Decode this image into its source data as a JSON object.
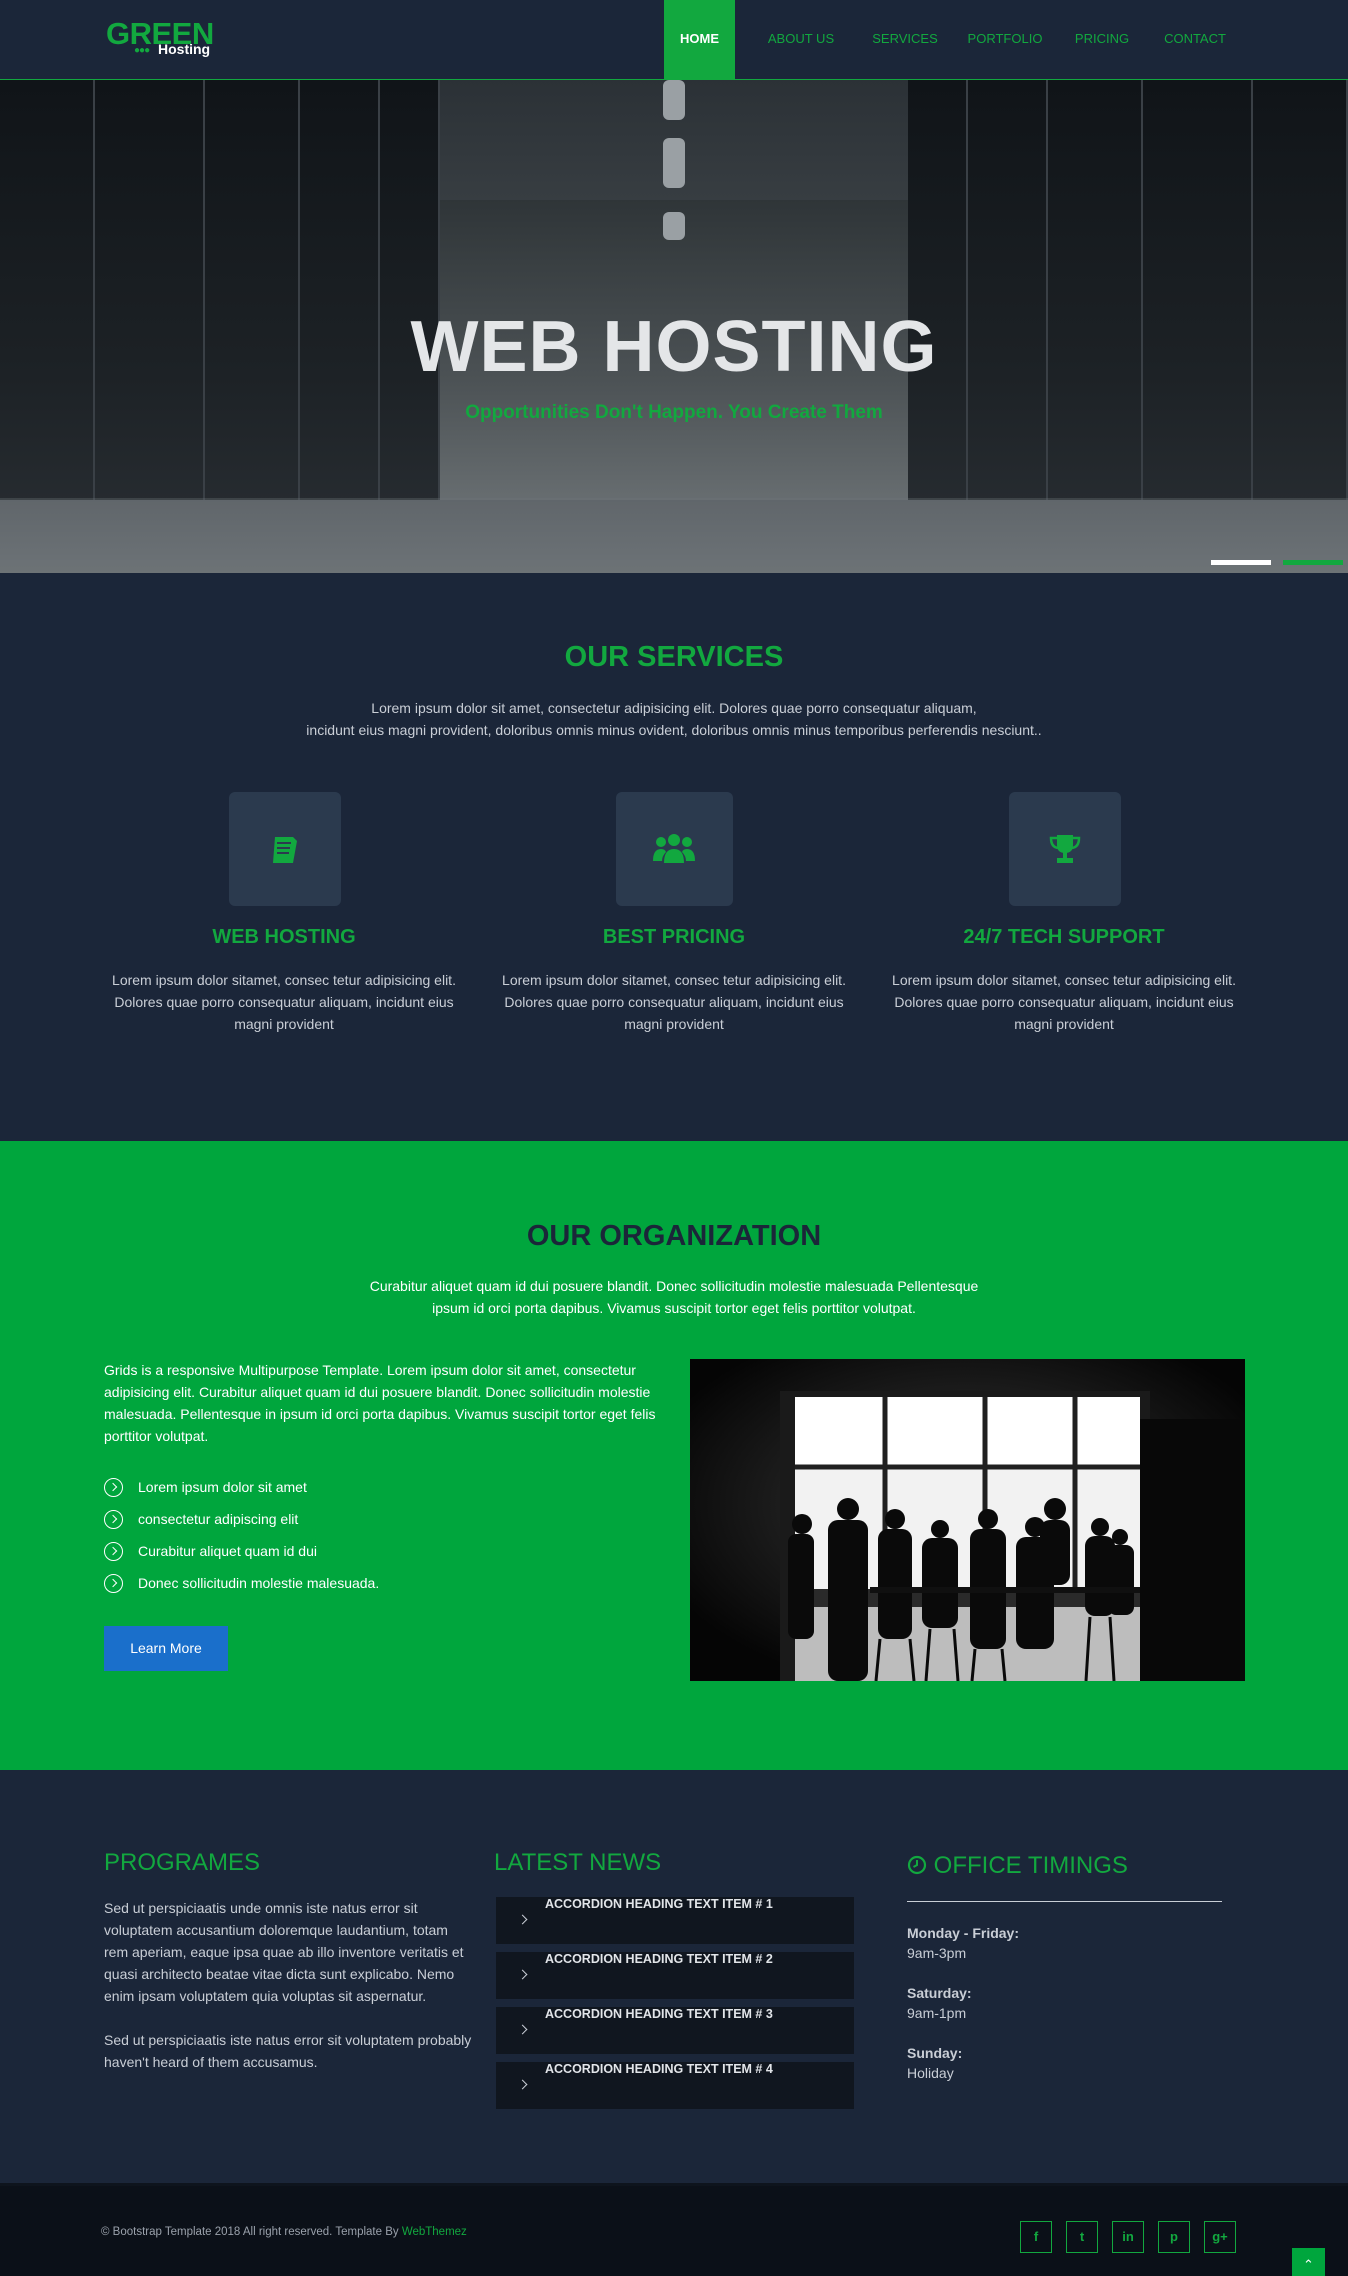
{
  "brand": {
    "logo_main": "GREEN",
    "logo_sub": "Hosting"
  },
  "nav": {
    "items": [
      {
        "label": "HOME",
        "active": true
      },
      {
        "label": "ABOUT US",
        "active": false
      },
      {
        "label": "SERVICES",
        "active": false
      },
      {
        "label": "PORTFOLIO",
        "active": false
      },
      {
        "label": "PRICING",
        "active": false
      },
      {
        "label": "CONTACT",
        "active": false
      }
    ]
  },
  "hero": {
    "title": "WEB HOSTING",
    "subtitle": "Opportunities Don't Happen. You Create Them",
    "slides": 2,
    "active_slide": 1
  },
  "services": {
    "title": "OUR SERVICES",
    "desc_line1": "Lorem ipsum dolor sit amet, consectetur adipisicing elit. Dolores quae porro consequatur aliquam,",
    "desc_line2": "incidunt eius magni provident, doloribus omnis minus ovident, doloribus omnis minus temporibus perferendis nesciunt..",
    "items": [
      {
        "icon": "book-icon",
        "title": "WEB HOSTING",
        "text": "Lorem ipsum dolor sitamet, consec tetur adipisicing elit. Dolores quae porro consequatur aliquam, incidunt eius magni provident"
      },
      {
        "icon": "users-icon",
        "title": "BEST PRICING",
        "text": "Lorem ipsum dolor sitamet, consec tetur adipisicing elit. Dolores quae porro consequatur aliquam, incidunt eius magni provident"
      },
      {
        "icon": "trophy-icon",
        "title": "24/7 TECH SUPPORT",
        "text": "Lorem ipsum dolor sitamet, consec tetur adipisicing elit. Dolores quae porro consequatur aliquam, incidunt eius magni provident"
      }
    ]
  },
  "organization": {
    "title": "OUR ORGANIZATION",
    "desc_line1": "Curabitur aliquet quam id dui posuere blandit. Donec sollicitudin molestie malesuada Pellentesque",
    "desc_line2": "ipsum id orci porta dapibus. Vivamus suscipit tortor eget felis porttitor volutpat.",
    "paragraph": "Grids is a responsive Multipurpose Template. Lorem ipsum dolor sit amet, consectetur adipisicing elit. Curabitur aliquet quam id dui posuere blandit. Donec sollicitudin molestie malesuada. Pellentesque in ipsum id orci porta dapibus. Vivamus suscipit tortor eget felis porttitor volutpat.",
    "list": [
      "Lorem ipsum dolor sit amet",
      "consectetur adipiscing elit",
      "Curabitur aliquet quam id dui",
      "Donec sollicitudin molestie malesuada."
    ],
    "button_label": "Learn More"
  },
  "programes": {
    "title": "PROGRAMES",
    "para1": "Sed ut perspiciaatis unde omnis iste natus error sit voluptatem accusantium doloremque laudantium, totam rem aperiam, eaque ipsa quae ab illo inventore veritatis et quasi architecto beatae vitae dicta sunt explicabo. Nemo enim ipsam voluptatem quia voluptas sit aspernatur.",
    "para2": "Sed ut perspiciaatis iste natus error sit voluptatem probably haven't heard of them accusamus."
  },
  "news": {
    "title": "LATEST NEWS",
    "items": [
      "ACCORDION HEADING TEXT ITEM # 1",
      "ACCORDION HEADING TEXT ITEM # 2",
      "ACCORDION HEADING TEXT ITEM # 3",
      "ACCORDION HEADING TEXT ITEM # 4"
    ]
  },
  "office": {
    "title": "OFFICE TIMINGS",
    "rows": [
      {
        "label": "Monday - Friday:",
        "value": "9am-3pm"
      },
      {
        "label": "Saturday:",
        "value": "9am-1pm"
      },
      {
        "label": "Sunday:",
        "value": "Holiday"
      }
    ]
  },
  "footer": {
    "copyright": "© Bootstrap Template 2018 All right reserved. Template By ",
    "link_text": "WebThemez",
    "social": [
      "f",
      "t",
      "in",
      "p",
      "g+"
    ],
    "social_icons": [
      "facebook-icon",
      "twitter-icon",
      "linkedin-icon",
      "pinterest-icon",
      "google-plus-icon"
    ],
    "to_top_icon": "chevron-up-icon"
  },
  "colors": {
    "accent": "#12a83f",
    "dark": "#1b2639",
    "org_bg": "#00a63d",
    "button": "#1a6fcb"
  }
}
